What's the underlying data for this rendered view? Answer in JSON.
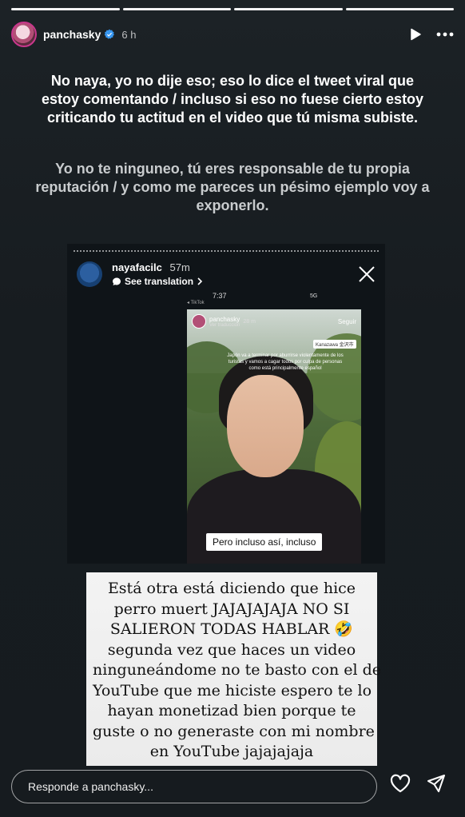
{
  "progress": {
    "segments": 4,
    "current": 4
  },
  "header": {
    "username": "panchasky",
    "time": "6 h"
  },
  "story_text": {
    "main": "No naya, yo no dije eso; eso lo dice el tweet viral que estoy comentando / incluso si eso no fuese cierto estoy criticando tu actitud en el video que tú misma subiste.",
    "secondary": "Yo no te ninguneo, tú eres responsable de tu propia reputación / y como me pareces un pésimo ejemplo voy a exponerlo."
  },
  "screenshot": {
    "username": "nayafacilc",
    "time": "57m",
    "see_translation": "See translation",
    "status_time": "7:37",
    "tiktok_label": "◂ TikTok",
    "signal_text": "5G",
    "inner_story": {
      "username": "panchasky",
      "time": "28 m",
      "subtitle": "Ver traducción",
      "follow": "Seguir",
      "location": "Kanazawa 金沢市",
      "caption": "Japón va a terminar por aburrirse violentamente de los turistas y vamos a cagar todos por culpa de personas como está principalmente español",
      "overlay_text": "Pero incluso así, incluso"
    }
  },
  "note": {
    "lines": [
      "Está otra está diciendo que hice",
      "perro muert JAJAJAJAJA NO SI",
      "SALIERON TODAS HABLAR 🤣",
      "segunda vez que haces un video",
      "ninguneándome no te basto con el de",
      "YouTube que me hiciste espero te lo",
      "hayan monetizad bien porque te",
      "guste o no generaste con mi nombre",
      "en YouTube jajajajaja"
    ]
  },
  "reply": {
    "placeholder": "Responde a panchasky..."
  },
  "colors": {
    "accent_ring": "#c9378c",
    "background": "#171c20"
  }
}
